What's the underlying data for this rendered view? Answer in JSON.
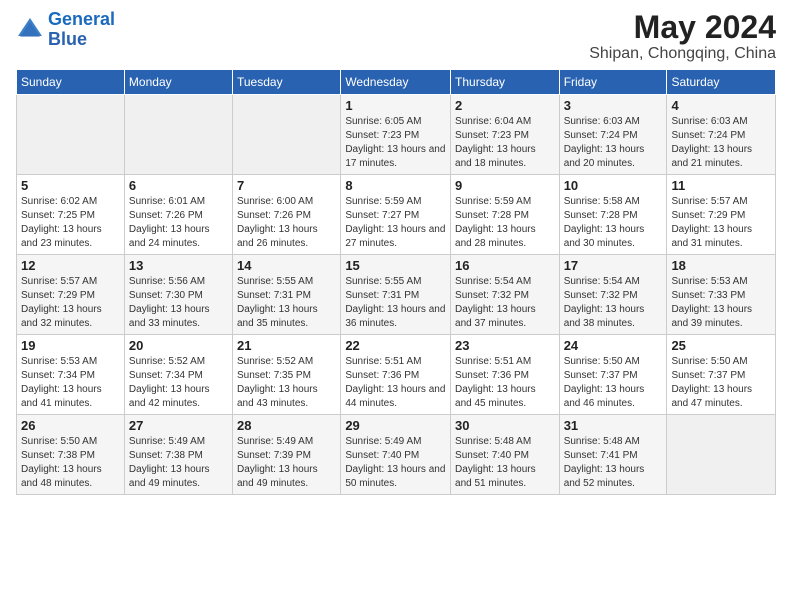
{
  "header": {
    "logo_line1": "General",
    "logo_line2": "Blue",
    "title": "May 2024",
    "subtitle": "Shipan, Chongqing, China"
  },
  "weekdays": [
    "Sunday",
    "Monday",
    "Tuesday",
    "Wednesday",
    "Thursday",
    "Friday",
    "Saturday"
  ],
  "weeks": [
    [
      {
        "day": "",
        "info": ""
      },
      {
        "day": "",
        "info": ""
      },
      {
        "day": "",
        "info": ""
      },
      {
        "day": "1",
        "info": "Sunrise: 6:05 AM\nSunset: 7:23 PM\nDaylight: 13 hours\nand 17 minutes."
      },
      {
        "day": "2",
        "info": "Sunrise: 6:04 AM\nSunset: 7:23 PM\nDaylight: 13 hours\nand 18 minutes."
      },
      {
        "day": "3",
        "info": "Sunrise: 6:03 AM\nSunset: 7:24 PM\nDaylight: 13 hours\nand 20 minutes."
      },
      {
        "day": "4",
        "info": "Sunrise: 6:03 AM\nSunset: 7:24 PM\nDaylight: 13 hours\nand 21 minutes."
      }
    ],
    [
      {
        "day": "5",
        "info": "Sunrise: 6:02 AM\nSunset: 7:25 PM\nDaylight: 13 hours\nand 23 minutes."
      },
      {
        "day": "6",
        "info": "Sunrise: 6:01 AM\nSunset: 7:26 PM\nDaylight: 13 hours\nand 24 minutes."
      },
      {
        "day": "7",
        "info": "Sunrise: 6:00 AM\nSunset: 7:26 PM\nDaylight: 13 hours\nand 26 minutes."
      },
      {
        "day": "8",
        "info": "Sunrise: 5:59 AM\nSunset: 7:27 PM\nDaylight: 13 hours\nand 27 minutes."
      },
      {
        "day": "9",
        "info": "Sunrise: 5:59 AM\nSunset: 7:28 PM\nDaylight: 13 hours\nand 28 minutes."
      },
      {
        "day": "10",
        "info": "Sunrise: 5:58 AM\nSunset: 7:28 PM\nDaylight: 13 hours\nand 30 minutes."
      },
      {
        "day": "11",
        "info": "Sunrise: 5:57 AM\nSunset: 7:29 PM\nDaylight: 13 hours\nand 31 minutes."
      }
    ],
    [
      {
        "day": "12",
        "info": "Sunrise: 5:57 AM\nSunset: 7:29 PM\nDaylight: 13 hours\nand 32 minutes."
      },
      {
        "day": "13",
        "info": "Sunrise: 5:56 AM\nSunset: 7:30 PM\nDaylight: 13 hours\nand 33 minutes."
      },
      {
        "day": "14",
        "info": "Sunrise: 5:55 AM\nSunset: 7:31 PM\nDaylight: 13 hours\nand 35 minutes."
      },
      {
        "day": "15",
        "info": "Sunrise: 5:55 AM\nSunset: 7:31 PM\nDaylight: 13 hours\nand 36 minutes."
      },
      {
        "day": "16",
        "info": "Sunrise: 5:54 AM\nSunset: 7:32 PM\nDaylight: 13 hours\nand 37 minutes."
      },
      {
        "day": "17",
        "info": "Sunrise: 5:54 AM\nSunset: 7:32 PM\nDaylight: 13 hours\nand 38 minutes."
      },
      {
        "day": "18",
        "info": "Sunrise: 5:53 AM\nSunset: 7:33 PM\nDaylight: 13 hours\nand 39 minutes."
      }
    ],
    [
      {
        "day": "19",
        "info": "Sunrise: 5:53 AM\nSunset: 7:34 PM\nDaylight: 13 hours\nand 41 minutes."
      },
      {
        "day": "20",
        "info": "Sunrise: 5:52 AM\nSunset: 7:34 PM\nDaylight: 13 hours\nand 42 minutes."
      },
      {
        "day": "21",
        "info": "Sunrise: 5:52 AM\nSunset: 7:35 PM\nDaylight: 13 hours\nand 43 minutes."
      },
      {
        "day": "22",
        "info": "Sunrise: 5:51 AM\nSunset: 7:36 PM\nDaylight: 13 hours\nand 44 minutes."
      },
      {
        "day": "23",
        "info": "Sunrise: 5:51 AM\nSunset: 7:36 PM\nDaylight: 13 hours\nand 45 minutes."
      },
      {
        "day": "24",
        "info": "Sunrise: 5:50 AM\nSunset: 7:37 PM\nDaylight: 13 hours\nand 46 minutes."
      },
      {
        "day": "25",
        "info": "Sunrise: 5:50 AM\nSunset: 7:37 PM\nDaylight: 13 hours\nand 47 minutes."
      }
    ],
    [
      {
        "day": "26",
        "info": "Sunrise: 5:50 AM\nSunset: 7:38 PM\nDaylight: 13 hours\nand 48 minutes."
      },
      {
        "day": "27",
        "info": "Sunrise: 5:49 AM\nSunset: 7:38 PM\nDaylight: 13 hours\nand 49 minutes."
      },
      {
        "day": "28",
        "info": "Sunrise: 5:49 AM\nSunset: 7:39 PM\nDaylight: 13 hours\nand 49 minutes."
      },
      {
        "day": "29",
        "info": "Sunrise: 5:49 AM\nSunset: 7:40 PM\nDaylight: 13 hours\nand 50 minutes."
      },
      {
        "day": "30",
        "info": "Sunrise: 5:48 AM\nSunset: 7:40 PM\nDaylight: 13 hours\nand 51 minutes."
      },
      {
        "day": "31",
        "info": "Sunrise: 5:48 AM\nSunset: 7:41 PM\nDaylight: 13 hours\nand 52 minutes."
      },
      {
        "day": "",
        "info": ""
      }
    ]
  ]
}
